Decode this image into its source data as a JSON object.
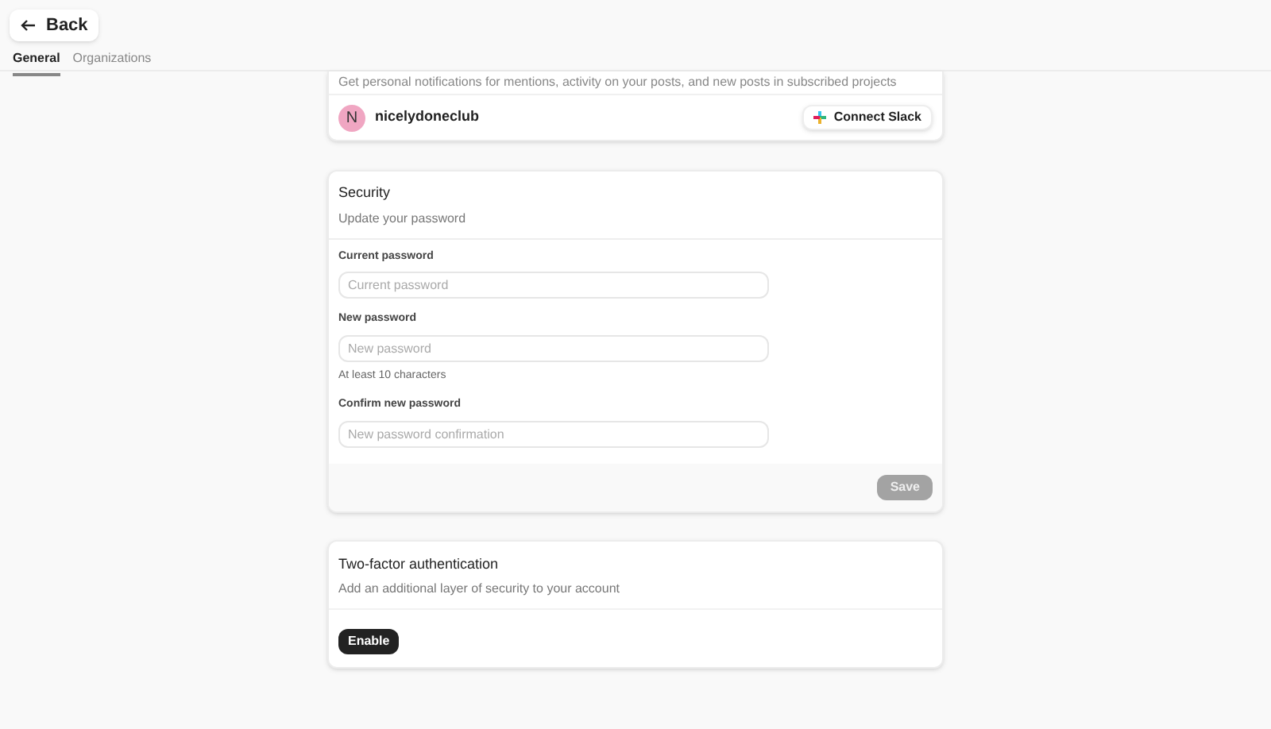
{
  "back_button": {
    "label": "Back"
  },
  "tabs": [
    {
      "label": "General",
      "selected": true
    },
    {
      "label": "Organizations",
      "selected": false
    }
  ],
  "notifications_card": {
    "description": "Get personal notifications for mentions, activity on your posts, and new posts in subscribed projects",
    "account": {
      "initial": "N",
      "name": "nicelydoneclub"
    },
    "button": "Connect Slack"
  },
  "security_card": {
    "title": "Security",
    "subtitle": "Update your password",
    "fields": [
      {
        "label": "Current password",
        "placeholder": "Current password"
      },
      {
        "label": "New password",
        "placeholder": "New password",
        "hint": "At least 10 characters"
      },
      {
        "label": "Confirm new password",
        "placeholder": "New password confirmation"
      }
    ],
    "save_button": {
      "label": "Save",
      "disabled": true
    }
  },
  "two_factor_card": {
    "title": "Two-factor authentication",
    "subtitle": "Add an additional layer of security to your account",
    "button": "Enable"
  }
}
